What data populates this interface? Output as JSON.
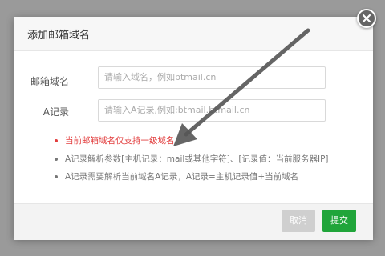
{
  "dialog": {
    "title": "添加邮箱域名",
    "close_icon": "close-icon"
  },
  "form": {
    "domain_label": "邮箱域名",
    "domain_placeholder": "请输入域名，例如btmail.cn",
    "a_record_label": "A记录",
    "a_record_placeholder": "请输入A记录,例如:btmail.btmail.cn"
  },
  "notes": [
    "当前邮箱域名仅支持一级域名",
    "A记录解析参数[主机记录：mail或其他字符]、[记录值：当前服务器IP]",
    "A记录需要解析当前域名A记录，A记录=主机记录值+当前域名"
  ],
  "footer": {
    "cancel_label": "取消",
    "submit_label": "提交"
  },
  "colors": {
    "warning": "#e23d3d",
    "submit": "#20a53a",
    "overlay": "#9a9a9a"
  }
}
